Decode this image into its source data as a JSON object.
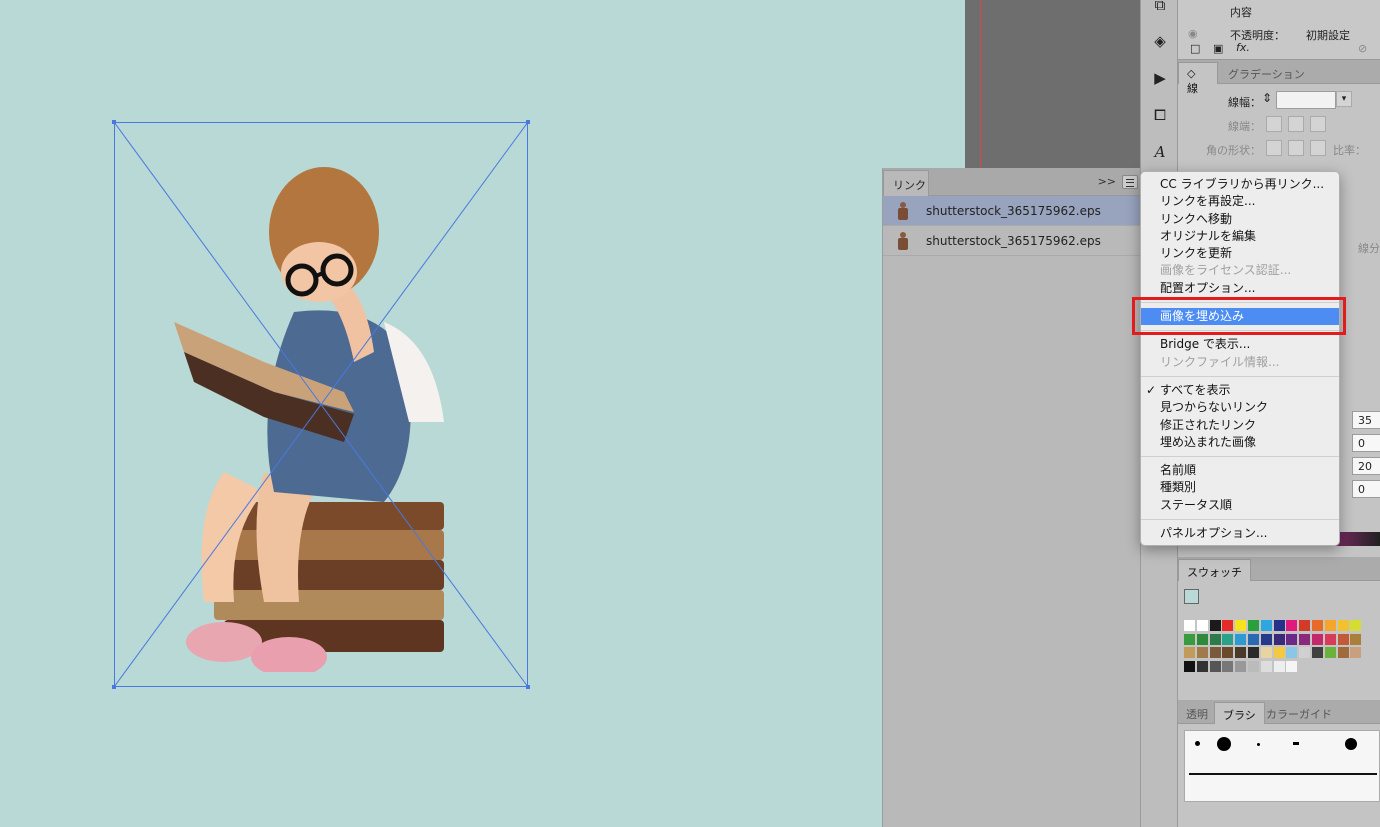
{
  "links_panel": {
    "tab_label": "リンク",
    "collapse_glyph": ">>",
    "items": [
      {
        "name": "shutterstock_365175962.eps",
        "selected": true
      },
      {
        "name": "shutterstock_365175962.eps",
        "selected": false
      }
    ]
  },
  "context_menu": {
    "group1": [
      "CC ライブラリから再リンク...",
      "リンクを再設定...",
      "リンクへ移動",
      "オリジナルを編集",
      "リンクを更新"
    ],
    "group1_disabled": [
      "画像をライセンス認証..."
    ],
    "group1_tail": [
      "配置オプション..."
    ],
    "highlighted": "画像を埋め込み",
    "group3": [
      "Bridge で表示..."
    ],
    "group3_disabled": [
      "リンクファイル情報..."
    ],
    "group4": [
      "すべてを表示",
      "見つからないリンク",
      "修正されたリンク",
      "埋め込まれた画像"
    ],
    "group4_checked_index": 0,
    "group5": [
      "名前順",
      "種類別",
      "ステータス順"
    ],
    "group6": [
      "パネルオプション..."
    ]
  },
  "appearance": {
    "content_label": "内容",
    "opacity_label": "不透明度：",
    "opacity_value": "初期設定",
    "fx_label": "fx."
  },
  "stroke_panel": {
    "tab_stroke": "線",
    "tab_gradient": "グラデーション",
    "weight_label": "線幅：",
    "cap_label": "線端：",
    "corner_label": "角の形状：",
    "ratio_label": "比率：",
    "dash_label": "線分"
  },
  "color_panel": {
    "values": [
      "35",
      "0",
      "20",
      "0"
    ],
    "colors": [
      "#1aa0d8",
      "#d6188c",
      "#e6d21a",
      "#111111"
    ]
  },
  "swatches": {
    "tab_label": "スウォッチ"
  },
  "brushes": {
    "tabs": [
      "透明",
      "ブラシ",
      "カラーガイド"
    ],
    "active_tab": "ブラシ"
  },
  "colors": {
    "canvas": "#b8d9d5",
    "selection": "#4a78e0",
    "menu_highlight": "#4d8cf3",
    "callout": "#e21c1c"
  }
}
